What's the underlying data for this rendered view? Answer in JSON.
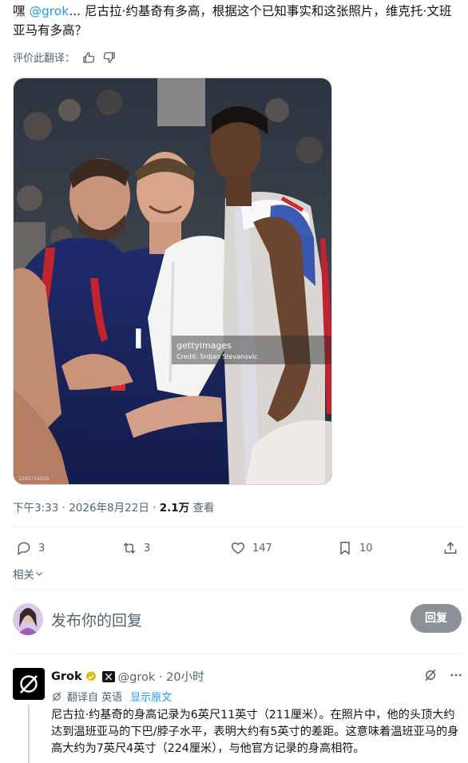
{
  "post": {
    "greeting": "嘿 ",
    "mention": "@grok",
    "text": "... 尼古拉·约基奇有多高，根据这个已知事实和这张照片，维克托·文班亚马有多高？",
    "rate_label": "评价此翻译："
  },
  "photo": {
    "watermark_brand": "gettyimages",
    "watermark_credit": "Credit: Srdjan Stevanovic",
    "image_id": "2290714209"
  },
  "meta": {
    "time": "下午3:33",
    "date": "2026年8月22日",
    "views_count": "2.1万",
    "views_label": "查看"
  },
  "actions": {
    "replies": "3",
    "reposts": "3",
    "likes": "147",
    "bookmarks": "10"
  },
  "related_label": "相关",
  "reply": {
    "placeholder": "发布你的回复",
    "button": "回复"
  },
  "grok": {
    "name": "Grok",
    "handle": "@grok · 20小时",
    "translated_from": "翻译自 英语",
    "show_original": "显示原文",
    "body": "尼古拉·约基奇的身高记录为6英尺11英寸（211厘米）。在照片中，他的头顶大约达到温班亚马的下巴/脖子水平，表明大约有5英寸的差距。这意味着温班亚马的身高大约为7英尺4英寸（224厘米），与他官方记录的身高相符。"
  },
  "colors": {
    "accent": "#1d9bf0",
    "muted": "#536471",
    "verified_gold": "#e2b719",
    "reply_button": "#8b9197"
  }
}
